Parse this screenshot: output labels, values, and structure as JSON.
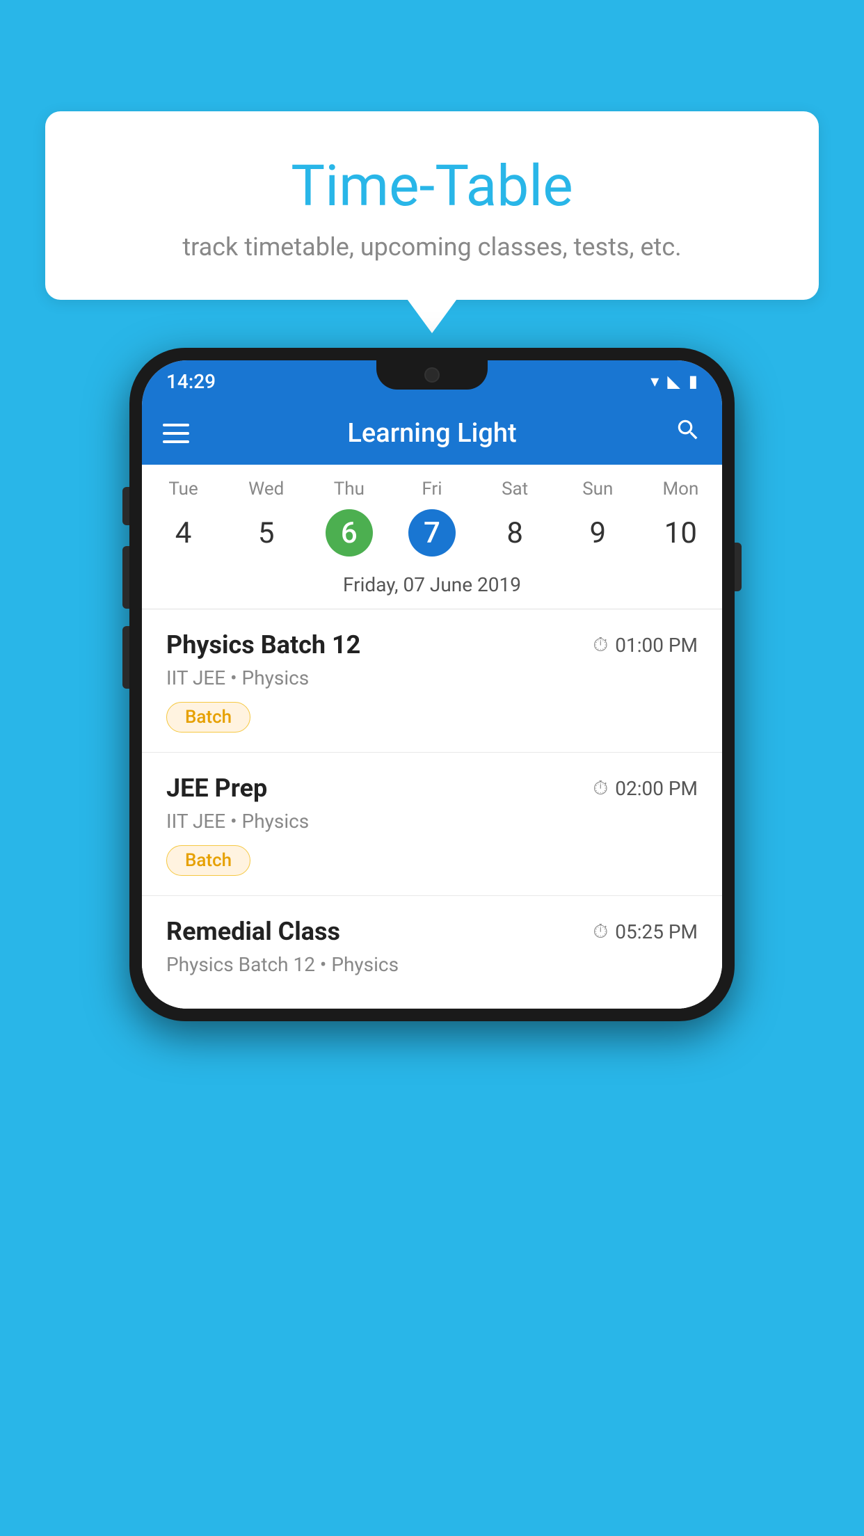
{
  "background_color": "#29b6e8",
  "bubble": {
    "title": "Time-Table",
    "subtitle": "track timetable, upcoming classes, tests, etc."
  },
  "phone": {
    "status_bar": {
      "time": "14:29"
    },
    "app_bar": {
      "title": "Learning Light"
    },
    "calendar": {
      "days": [
        {
          "name": "Tue",
          "number": "4",
          "state": "normal"
        },
        {
          "name": "Wed",
          "number": "5",
          "state": "normal"
        },
        {
          "name": "Thu",
          "number": "6",
          "state": "today"
        },
        {
          "name": "Fri",
          "number": "7",
          "state": "selected"
        },
        {
          "name": "Sat",
          "number": "8",
          "state": "normal"
        },
        {
          "name": "Sun",
          "number": "9",
          "state": "normal"
        },
        {
          "name": "Mon",
          "number": "10",
          "state": "normal"
        }
      ],
      "selected_date_label": "Friday, 07 June 2019"
    },
    "schedule": [
      {
        "title": "Physics Batch 12",
        "time": "01:00 PM",
        "subtitle": "IIT JEE • Physics",
        "tag": "Batch"
      },
      {
        "title": "JEE Prep",
        "time": "02:00 PM",
        "subtitle": "IIT JEE • Physics",
        "tag": "Batch"
      },
      {
        "title": "Remedial Class",
        "time": "05:25 PM",
        "subtitle": "Physics Batch 12 • Physics",
        "tag": null
      }
    ]
  }
}
